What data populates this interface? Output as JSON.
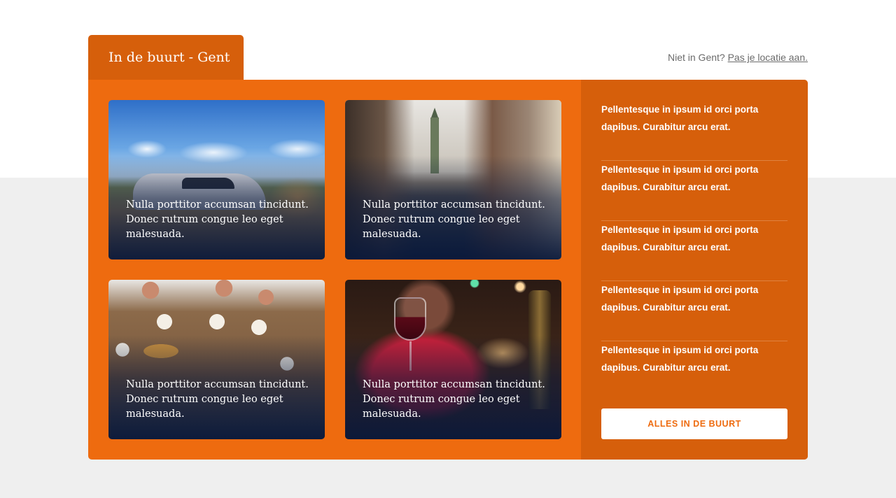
{
  "header": {
    "tab_title": "In de buurt - Gent",
    "location_prefix": "Niet in Gent?",
    "location_link": "Pas je locatie aan."
  },
  "cards": [
    {
      "caption": "Nulla porttitor accumsan tincidunt. Donec rutrum congue leo eget malesuada."
    },
    {
      "caption": "Nulla porttitor accumsan tincidunt. Donec rutrum congue leo eget malesuada."
    },
    {
      "caption": "Nulla porttitor accumsan tincidunt. Donec rutrum congue leo eget malesuada."
    },
    {
      "caption": "Nulla porttitor accumsan tincidunt. Donec rutrum congue leo eget malesuada."
    }
  ],
  "sidebar": {
    "items": [
      {
        "label": "Pellentesque in ipsum id orci porta dapibus. Curabitur arcu erat."
      },
      {
        "label": "Pellentesque in ipsum id orci porta dapibus. Curabitur arcu erat."
      },
      {
        "label": "Pellentesque in ipsum id orci porta dapibus. Curabitur arcu erat."
      },
      {
        "label": "Pellentesque in ipsum id orci porta dapibus. Curabitur arcu erat."
      },
      {
        "label": "Pellentesque in ipsum id orci porta dapibus. Curabitur arcu erat."
      }
    ],
    "button_label": "ALLES IN DE BUURT"
  },
  "colors": {
    "panel_orange": "#ee6b0f",
    "dark_orange": "#d65f0b",
    "page_gray": "#efefef",
    "caption_overlay": "#09183a"
  }
}
